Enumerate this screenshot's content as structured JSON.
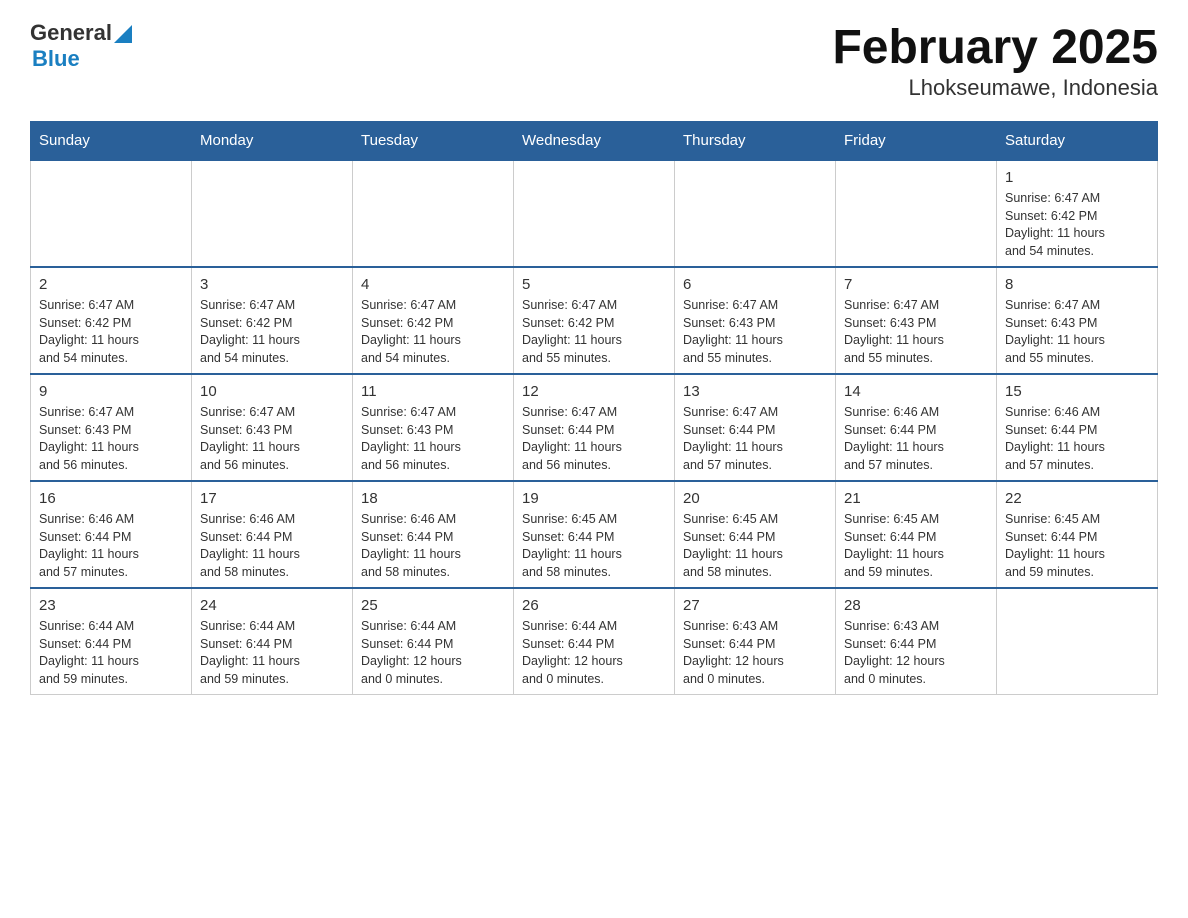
{
  "header": {
    "logo_general": "General",
    "logo_blue": "Blue",
    "title": "February 2025",
    "subtitle": "Lhokseumawe, Indonesia"
  },
  "weekdays": [
    "Sunday",
    "Monday",
    "Tuesday",
    "Wednesday",
    "Thursday",
    "Friday",
    "Saturday"
  ],
  "weeks": [
    [
      {
        "day": "",
        "info": ""
      },
      {
        "day": "",
        "info": ""
      },
      {
        "day": "",
        "info": ""
      },
      {
        "day": "",
        "info": ""
      },
      {
        "day": "",
        "info": ""
      },
      {
        "day": "",
        "info": ""
      },
      {
        "day": "1",
        "info": "Sunrise: 6:47 AM\nSunset: 6:42 PM\nDaylight: 11 hours\nand 54 minutes."
      }
    ],
    [
      {
        "day": "2",
        "info": "Sunrise: 6:47 AM\nSunset: 6:42 PM\nDaylight: 11 hours\nand 54 minutes."
      },
      {
        "day": "3",
        "info": "Sunrise: 6:47 AM\nSunset: 6:42 PM\nDaylight: 11 hours\nand 54 minutes."
      },
      {
        "day": "4",
        "info": "Sunrise: 6:47 AM\nSunset: 6:42 PM\nDaylight: 11 hours\nand 54 minutes."
      },
      {
        "day": "5",
        "info": "Sunrise: 6:47 AM\nSunset: 6:42 PM\nDaylight: 11 hours\nand 55 minutes."
      },
      {
        "day": "6",
        "info": "Sunrise: 6:47 AM\nSunset: 6:43 PM\nDaylight: 11 hours\nand 55 minutes."
      },
      {
        "day": "7",
        "info": "Sunrise: 6:47 AM\nSunset: 6:43 PM\nDaylight: 11 hours\nand 55 minutes."
      },
      {
        "day": "8",
        "info": "Sunrise: 6:47 AM\nSunset: 6:43 PM\nDaylight: 11 hours\nand 55 minutes."
      }
    ],
    [
      {
        "day": "9",
        "info": "Sunrise: 6:47 AM\nSunset: 6:43 PM\nDaylight: 11 hours\nand 56 minutes."
      },
      {
        "day": "10",
        "info": "Sunrise: 6:47 AM\nSunset: 6:43 PM\nDaylight: 11 hours\nand 56 minutes."
      },
      {
        "day": "11",
        "info": "Sunrise: 6:47 AM\nSunset: 6:43 PM\nDaylight: 11 hours\nand 56 minutes."
      },
      {
        "day": "12",
        "info": "Sunrise: 6:47 AM\nSunset: 6:44 PM\nDaylight: 11 hours\nand 56 minutes."
      },
      {
        "day": "13",
        "info": "Sunrise: 6:47 AM\nSunset: 6:44 PM\nDaylight: 11 hours\nand 57 minutes."
      },
      {
        "day": "14",
        "info": "Sunrise: 6:46 AM\nSunset: 6:44 PM\nDaylight: 11 hours\nand 57 minutes."
      },
      {
        "day": "15",
        "info": "Sunrise: 6:46 AM\nSunset: 6:44 PM\nDaylight: 11 hours\nand 57 minutes."
      }
    ],
    [
      {
        "day": "16",
        "info": "Sunrise: 6:46 AM\nSunset: 6:44 PM\nDaylight: 11 hours\nand 57 minutes."
      },
      {
        "day": "17",
        "info": "Sunrise: 6:46 AM\nSunset: 6:44 PM\nDaylight: 11 hours\nand 58 minutes."
      },
      {
        "day": "18",
        "info": "Sunrise: 6:46 AM\nSunset: 6:44 PM\nDaylight: 11 hours\nand 58 minutes."
      },
      {
        "day": "19",
        "info": "Sunrise: 6:45 AM\nSunset: 6:44 PM\nDaylight: 11 hours\nand 58 minutes."
      },
      {
        "day": "20",
        "info": "Sunrise: 6:45 AM\nSunset: 6:44 PM\nDaylight: 11 hours\nand 58 minutes."
      },
      {
        "day": "21",
        "info": "Sunrise: 6:45 AM\nSunset: 6:44 PM\nDaylight: 11 hours\nand 59 minutes."
      },
      {
        "day": "22",
        "info": "Sunrise: 6:45 AM\nSunset: 6:44 PM\nDaylight: 11 hours\nand 59 minutes."
      }
    ],
    [
      {
        "day": "23",
        "info": "Sunrise: 6:44 AM\nSunset: 6:44 PM\nDaylight: 11 hours\nand 59 minutes."
      },
      {
        "day": "24",
        "info": "Sunrise: 6:44 AM\nSunset: 6:44 PM\nDaylight: 11 hours\nand 59 minutes."
      },
      {
        "day": "25",
        "info": "Sunrise: 6:44 AM\nSunset: 6:44 PM\nDaylight: 12 hours\nand 0 minutes."
      },
      {
        "day": "26",
        "info": "Sunrise: 6:44 AM\nSunset: 6:44 PM\nDaylight: 12 hours\nand 0 minutes."
      },
      {
        "day": "27",
        "info": "Sunrise: 6:43 AM\nSunset: 6:44 PM\nDaylight: 12 hours\nand 0 minutes."
      },
      {
        "day": "28",
        "info": "Sunrise: 6:43 AM\nSunset: 6:44 PM\nDaylight: 12 hours\nand 0 minutes."
      },
      {
        "day": "",
        "info": ""
      }
    ]
  ]
}
